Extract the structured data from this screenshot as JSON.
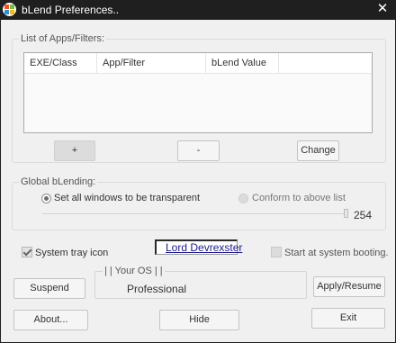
{
  "window": {
    "title": "bLend Preferences..",
    "close_glyph": "✕",
    "icon": "windows-logo-icon"
  },
  "apps_group": {
    "title": "List of Apps/Filters:",
    "columns": [
      "EXE/Class",
      "App/Filter",
      "bLend Value"
    ],
    "rows": [],
    "add_label": "+",
    "remove_label": "-",
    "change_label": "Change"
  },
  "global_group": {
    "title": "Global bLending:",
    "radio_all": "Set all windows to be transparent",
    "radio_list": "Conform to above list",
    "selected": "all",
    "slider_value": "254"
  },
  "system_tray": {
    "label": "System tray icon",
    "checked": true
  },
  "author_link": "Lord Devrexster",
  "start_at_boot": {
    "label": "Start at system booting.",
    "checked": false
  },
  "os": {
    "title": "| | Your OS | |",
    "value": "Professional"
  },
  "buttons": {
    "suspend": "Suspend",
    "apply": "Apply/Resume",
    "about": "About...",
    "hide": "Hide",
    "exit": "Exit"
  },
  "colors": {
    "titlebar": "#1f1f1f",
    "client_bg": "#f0f0f0",
    "link": "#1a1a8c"
  }
}
